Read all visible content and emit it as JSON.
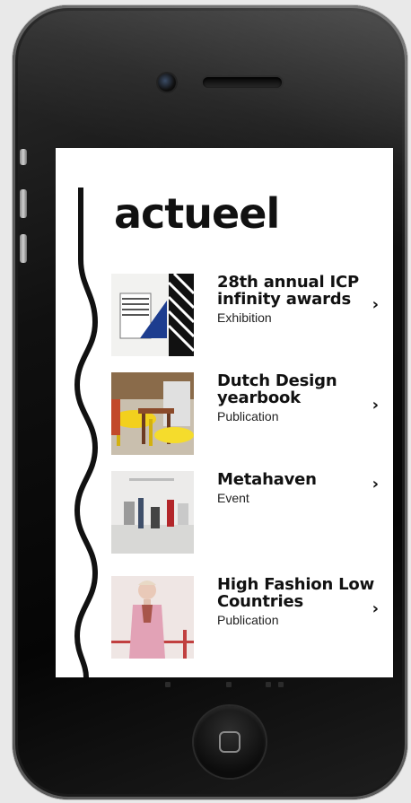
{
  "screen": {
    "title": "actueel",
    "items": [
      {
        "title": "28th annual ICP infinity awards",
        "type": "Exhibition",
        "thumb_icon": "geometric-poster-thumbnail"
      },
      {
        "title": "Dutch Design yearbook",
        "type": "Publication",
        "thumb_icon": "yellow-chairs-thumbnail"
      },
      {
        "title": "Metahaven",
        "type": "Event",
        "thumb_icon": "gallery-room-thumbnail"
      },
      {
        "title": "High Fashion Low Countries",
        "type": "Publication",
        "thumb_icon": "fashion-model-thumbnail"
      }
    ],
    "chevron": "›",
    "chevron_icon": "chevron-right-icon"
  },
  "colors": {
    "text": "#111111",
    "background": "#ffffff",
    "phone_body": "#0b0b0b"
  }
}
